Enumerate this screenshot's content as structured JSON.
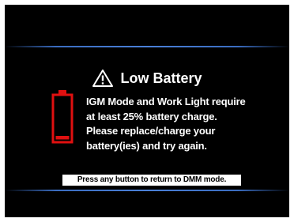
{
  "dialog": {
    "title": "Low Battery",
    "icon": "warning-triangle-icon",
    "battery_icon": "battery-empty-icon",
    "message_lines": [
      "IGM Mode and Work Light require",
      "at least 25% battery charge.",
      "Please replace/charge your",
      "battery(ies) and try again."
    ],
    "footer": "Press any button to return to DMM mode."
  },
  "colors": {
    "background": "#000000",
    "text": "#ffffff",
    "accent_line": "#3a6cc0",
    "battery": "#e01010",
    "footer_bg": "#ffffff",
    "footer_text": "#000000"
  }
}
